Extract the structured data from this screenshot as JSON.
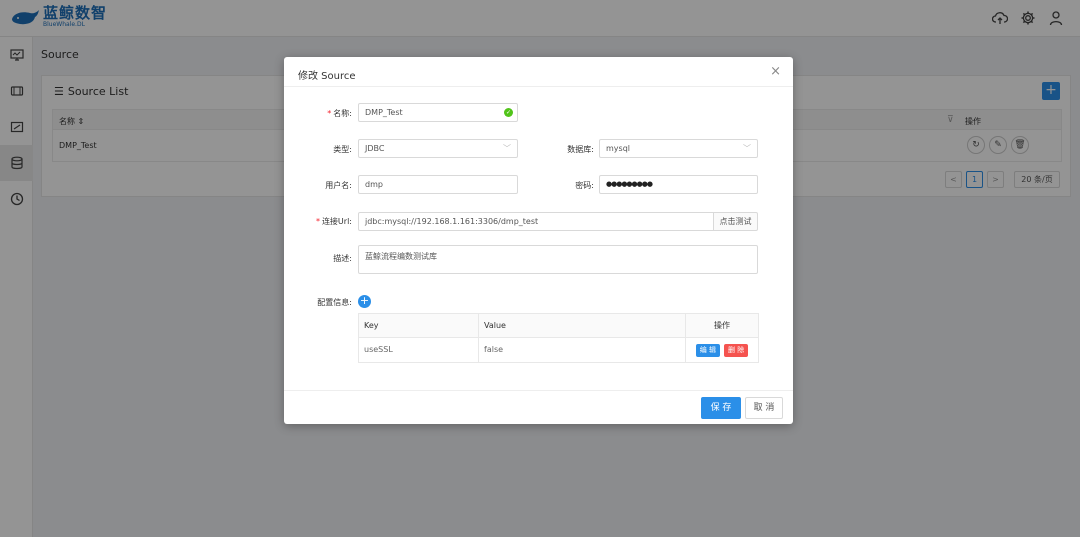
{
  "app": {
    "logo_cn": "蓝鲸数智",
    "logo_en": "BlueWhale.DL"
  },
  "breadcrumb": "Source",
  "list": {
    "title": "Source List",
    "columns": {
      "name": "名称 ⇕",
      "op": "操作"
    },
    "rows": [
      {
        "name": "DMP_Test"
      }
    ],
    "pager": {
      "prev": "<",
      "current": "1",
      "next": ">",
      "page_size": "20 条/页"
    }
  },
  "modal": {
    "title": "修改 Source",
    "close": "×",
    "fields": {
      "name_label": "名称:",
      "name_value": "DMP_Test",
      "type_label": "类型:",
      "type_value": "JDBC",
      "db_label": "数据库:",
      "db_value": "mysql",
      "user_label": "用户名:",
      "user_value": "dmp",
      "pwd_label": "密码:",
      "pwd_value": "●●●●●●●●●",
      "url_label": "连接Url:",
      "url_value": "jdbc:mysql://192.168.1.161:3306/dmp_test",
      "url_test": "点击测试",
      "desc_label": "描述:",
      "desc_value": "蓝鲸流程编数测试库",
      "cfg_label": "配置信息:"
    },
    "config_table": {
      "headers": {
        "key": "Key",
        "value": "Value",
        "op": "操作"
      },
      "rows": [
        {
          "key": "useSSL",
          "value": "false",
          "edit": "编 辑",
          "del": "删 除"
        }
      ]
    },
    "footer": {
      "save": "保 存",
      "cancel": "取 消"
    }
  },
  "colors": {
    "primary": "#2b8fe8",
    "danger": "#f5534f",
    "success": "#52c41a",
    "logo": "#1e6fb8"
  },
  "icons": [
    "cloud-upload-icon",
    "gear-icon",
    "user-icon",
    "monitor-icon",
    "film-icon",
    "chart-icon",
    "database-icon",
    "clock-icon",
    "refresh-icon",
    "edit-icon",
    "trash-icon",
    "check-icon",
    "list-icon"
  ]
}
